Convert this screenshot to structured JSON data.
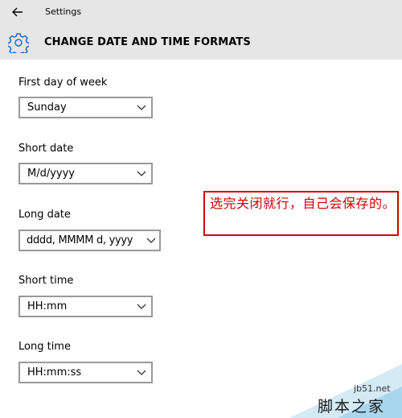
{
  "header": {
    "app_title": "Settings",
    "page_title": "CHANGE DATE AND TIME FORMATS"
  },
  "fields": [
    {
      "label": "First day of week",
      "value": "Sunday"
    },
    {
      "label": "Short date",
      "value": "M/d/yyyy"
    },
    {
      "label": "Long date",
      "value": "dddd, MMMM d, yyyy"
    },
    {
      "label": "Short time",
      "value": "HH:mm"
    },
    {
      "label": "Long time",
      "value": "HH:mm:ss"
    }
  ],
  "annotation": {
    "text": "选完关闭就行，自己会保存的。",
    "color": "#d40000"
  },
  "watermark": {
    "url": "jb51.net",
    "site": "脚本之家"
  },
  "colors": {
    "header_bg": "#e6e6e6",
    "accent": "#1a6fc4",
    "select_border": "#999999"
  }
}
